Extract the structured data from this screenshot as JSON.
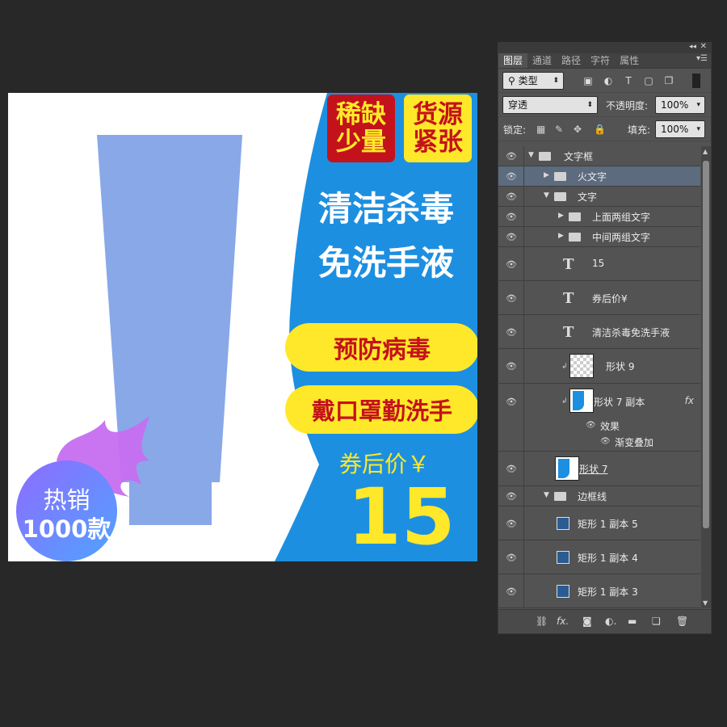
{
  "canvas": {
    "tags": {
      "scarce": [
        "稀缺",
        "少量"
      ],
      "short": [
        "货源",
        "紧张"
      ]
    },
    "headline": [
      "清洁杀毒",
      "免洗手液"
    ],
    "pills": [
      "预防病毒",
      "戴口罩勤洗手"
    ],
    "coupon_label": "券后价￥",
    "price": "15",
    "hot_badge": {
      "title": "热销",
      "count": "1000款"
    },
    "colors": {
      "blue": "#1d8fe0",
      "yellow": "#ffe829",
      "red": "#c4121c",
      "bottle": "#88a8e8"
    }
  },
  "panel": {
    "tabs": [
      "图层",
      "通道",
      "路径",
      "字符",
      "属性"
    ],
    "active_tab": "图层",
    "filter_kind": "类型",
    "blend_mode": "穿透",
    "opacity_label": "不透明度:",
    "opacity_value": "100%",
    "lock_label": "锁定:",
    "fill_label": "填充:",
    "fill_value": "100%",
    "layers": {
      "group_text_frame": "文字框",
      "group_fire_text": "火文字",
      "group_text": "文字",
      "group_top_text": "上面两组文字",
      "group_mid_text": "中间两组文字",
      "text_15": "15",
      "text_coupon": "券后价¥",
      "text_headline": "清洁杀毒免洗手液",
      "shape_9": "形状 9",
      "shape_7_copy": "形状 7 副本",
      "effects": "效果",
      "gradient_overlay": "渐变叠加",
      "shape_7": "形状 7",
      "group_border": "边框线",
      "rect_copy_5": "矩形 1 副本 5",
      "rect_copy_4": "矩形 1 副本 4",
      "rect_copy_3": "矩形 1 副本 3"
    },
    "fx_label": "fx"
  }
}
